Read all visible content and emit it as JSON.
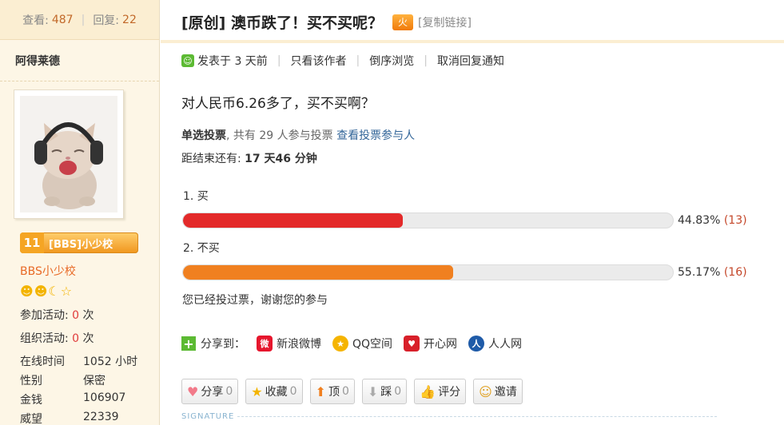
{
  "sidebar": {
    "views_label": "查看:",
    "views": "487",
    "replies_label": "回复:",
    "replies": "22",
    "author": "阿得莱德",
    "badge_level": "11",
    "badge_text": "[BBS]小少校",
    "group_name": "BBS小少校",
    "activity_join_label": "参加活动:",
    "activity_join_value": "0",
    "activity_join_unit": "次",
    "activity_org_label": "组织活动:",
    "activity_org_value": "0",
    "activity_org_unit": "次",
    "info": [
      {
        "k": "在线时间",
        "v": "1052 小时"
      },
      {
        "k": "性别",
        "v": "保密"
      },
      {
        "k": "金钱",
        "v": "106907"
      },
      {
        "k": "威望",
        "v": "22339"
      }
    ]
  },
  "post": {
    "title": "[原创] 澳币跌了！买不买呢？",
    "hot_icon": "火",
    "copy_link": "[复制链接]",
    "posted": "发表于 3 天前",
    "only_author": "只看该作者",
    "reverse": "倒序浏览",
    "cancel_notify": "取消回复通知",
    "question": "对人民币6.26多了，买不买啊？",
    "poll_type": "单选投票",
    "poll_count_text": ", 共有 29 人参与投票",
    "poll_link": "查看投票参与人",
    "deadline_label": "距结束还有:",
    "deadline_value": "17 天46 分钟",
    "voted_msg": "您已经投过票，谢谢您的参与"
  },
  "poll": {
    "options": [
      {
        "label": "1.  买",
        "percent": 44.83,
        "percent_text": "44.83%",
        "count": "(13)",
        "color": "#e32a2a"
      },
      {
        "label": "2.  不买",
        "percent": 55.17,
        "percent_text": "55.17%",
        "count": "(16)",
        "color": "#f08020"
      }
    ]
  },
  "share": {
    "label": "分享到：",
    "targets": [
      "新浪微博",
      "QQ空间",
      "开心网",
      "人人网"
    ]
  },
  "actions": {
    "share": "分享",
    "share_n": "0",
    "fav": "收藏",
    "fav_n": "0",
    "up": "顶",
    "up_n": "0",
    "down": "踩",
    "down_n": "0",
    "rate": "评分",
    "invite": "邀请"
  },
  "signature": "SIGNATURE"
}
